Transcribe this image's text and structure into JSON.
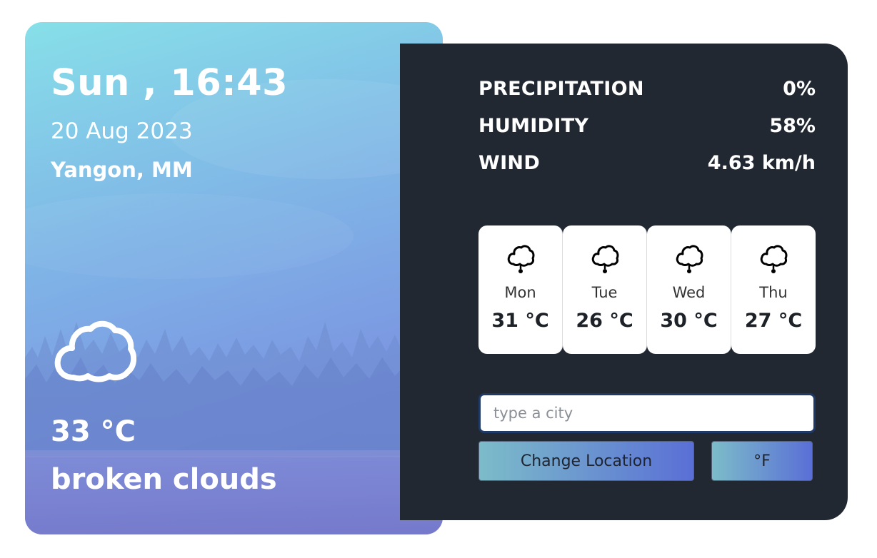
{
  "current": {
    "day_time": "Sun , 16:43",
    "date": "20 Aug 2023",
    "location": "Yangon, MM",
    "icon": "cloud-icon",
    "temperature": "33 °C",
    "description": "broken clouds"
  },
  "stats": [
    {
      "label": "PRECIPITATION",
      "value": "0%"
    },
    {
      "label": "HUMIDITY",
      "value": "58%"
    },
    {
      "label": "WIND",
      "value": "4.63 km/h"
    }
  ],
  "forecast": [
    {
      "day": "Mon",
      "temp": "31 °C",
      "icon": "rain-cloud-icon"
    },
    {
      "day": "Tue",
      "temp": "26 °C",
      "icon": "rain-cloud-icon"
    },
    {
      "day": "Wed",
      "temp": "30 °C",
      "icon": "rain-cloud-icon"
    },
    {
      "day": "Thu",
      "temp": "27 °C",
      "icon": "rain-cloud-icon"
    }
  ],
  "search": {
    "value": "",
    "placeholder": "type a city"
  },
  "buttons": {
    "change_location": "Change Location",
    "unit_toggle": "°F"
  },
  "colors": {
    "panel_bg": "#222831",
    "accent_start": "#7cbcc9",
    "accent_end": "#5a6fd6"
  }
}
